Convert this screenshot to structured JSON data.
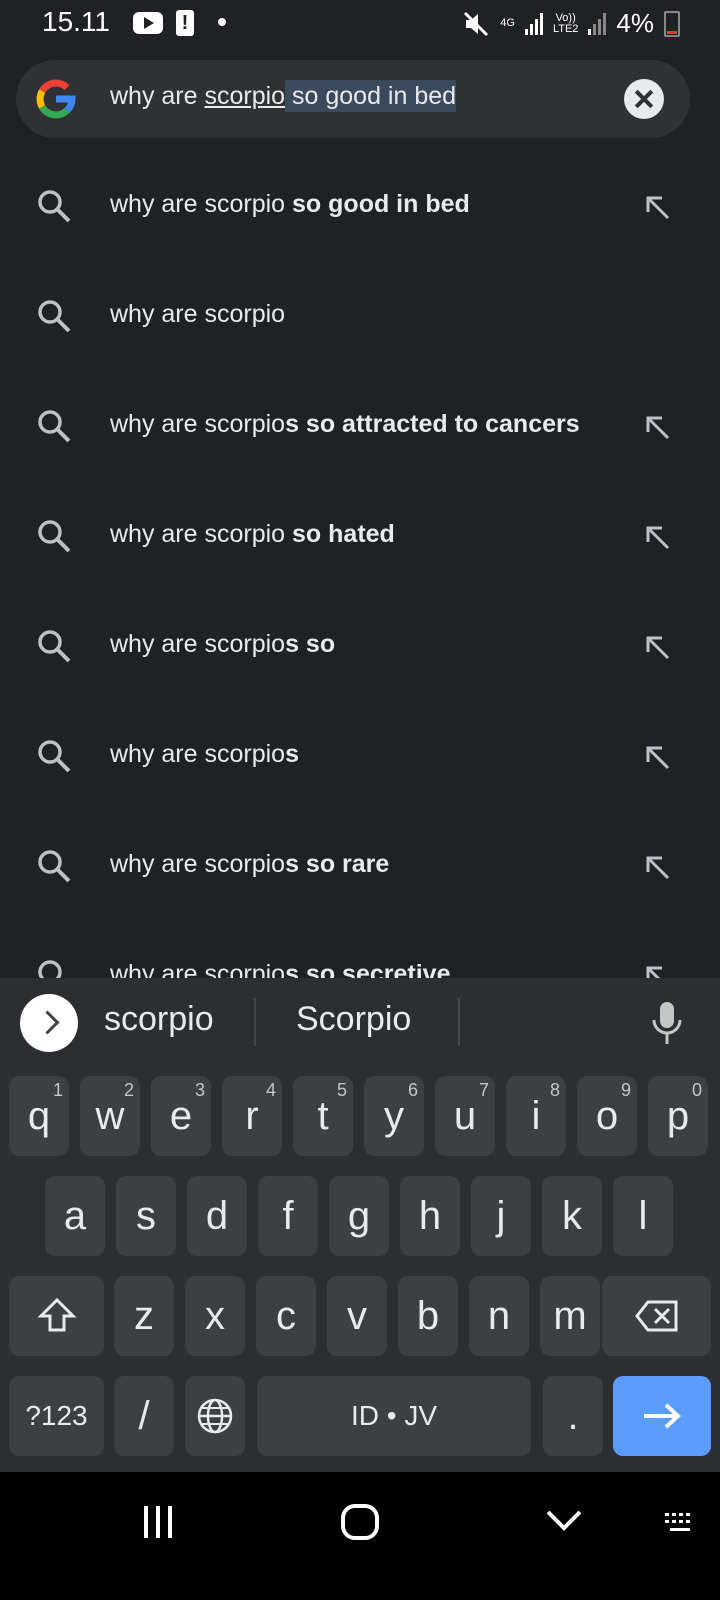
{
  "status": {
    "time": "15.11",
    "net_top": "4G",
    "lte_label": "Vo))\nLTE2",
    "battery": "4%"
  },
  "search": {
    "query_plain": "why are ",
    "query_underlined": "scorpio",
    "query_selected": " so good in bed"
  },
  "suggestions": [
    {
      "prefix": "why are scorpio ",
      "bold": "so good in bed",
      "has_fill": true
    },
    {
      "prefix": "why are scorpio",
      "bold": "",
      "has_fill": false
    },
    {
      "prefix": "why are scorpio",
      "bold": "s so attracted to cancers",
      "has_fill": true
    },
    {
      "prefix": "why are scorpio ",
      "bold": "so hated",
      "has_fill": true
    },
    {
      "prefix": "why are scorpio",
      "bold": "s so",
      "has_fill": true
    },
    {
      "prefix": "why are scorpio",
      "bold": "s",
      "has_fill": true
    },
    {
      "prefix": "why are scorpio",
      "bold": "s so rare",
      "has_fill": true
    },
    {
      "prefix": "why are scorpio",
      "bold": "s so secretive",
      "has_fill": true
    }
  ],
  "keyboard": {
    "word_suggestions": [
      "scorpio",
      "Scorpio"
    ],
    "row1": [
      {
        "k": "q",
        "n": "1"
      },
      {
        "k": "w",
        "n": "2"
      },
      {
        "k": "e",
        "n": "3"
      },
      {
        "k": "r",
        "n": "4"
      },
      {
        "k": "t",
        "n": "5"
      },
      {
        "k": "y",
        "n": "6"
      },
      {
        "k": "u",
        "n": "7"
      },
      {
        "k": "i",
        "n": "8"
      },
      {
        "k": "o",
        "n": "9"
      },
      {
        "k": "p",
        "n": "0"
      }
    ],
    "row2": [
      "a",
      "s",
      "d",
      "f",
      "g",
      "h",
      "j",
      "k",
      "l"
    ],
    "row3": [
      "z",
      "x",
      "c",
      "v",
      "b",
      "n",
      "m"
    ],
    "symbols_label": "?123",
    "slash_label": "/",
    "space_label": "ID • JV",
    "period_label": "."
  }
}
